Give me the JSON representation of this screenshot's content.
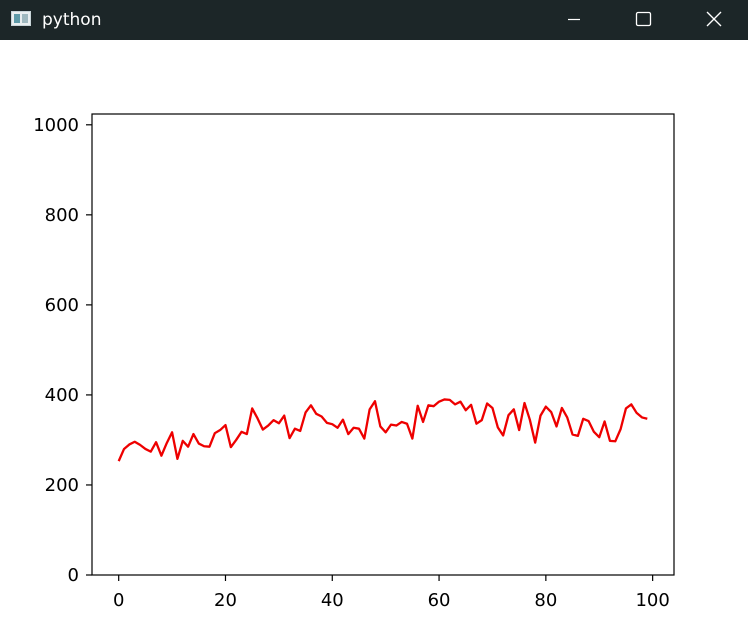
{
  "window": {
    "title": "python",
    "icons": {
      "app": "python-figure-icon",
      "minimize": "minimize-icon",
      "maximize": "maximize-icon",
      "close": "close-icon"
    }
  },
  "colors": {
    "titlebar": "#1c2628",
    "line": "#ee0000",
    "axes": "#000000",
    "background": "#ffffff"
  },
  "chart_data": {
    "type": "line",
    "title": "",
    "xlabel": "",
    "ylabel": "",
    "xlim": [
      -5,
      104
    ],
    "ylim": [
      0,
      1024
    ],
    "grid": false,
    "x_ticks": [
      "0",
      "20",
      "40",
      "60",
      "80",
      "100"
    ],
    "y_ticks": [
      "0",
      "200",
      "400",
      "600",
      "800",
      "1000"
    ],
    "series": [
      {
        "x": [
          0,
          1,
          2,
          3,
          4,
          5,
          6,
          7,
          8,
          9,
          10,
          11,
          12,
          13,
          14,
          15,
          16,
          17,
          18,
          19,
          20,
          21,
          22,
          23,
          24,
          25,
          26,
          27,
          28,
          29,
          30,
          31,
          32,
          33,
          34,
          35,
          36,
          37,
          38,
          39,
          40,
          41,
          42,
          43,
          44,
          45,
          46,
          47,
          48,
          49,
          50,
          51,
          52,
          53,
          54,
          55,
          56,
          57,
          58,
          59,
          60,
          61,
          62,
          63,
          64,
          65,
          66,
          67,
          68,
          69,
          70,
          71,
          72,
          73,
          74,
          75,
          76,
          77,
          78,
          79,
          80,
          81,
          82,
          83,
          84,
          85,
          86,
          87,
          88,
          89,
          90,
          91,
          92,
          93,
          94,
          95,
          96,
          97,
          98,
          99
        ],
        "y": [
          253,
          280,
          290,
          296,
          289,
          280,
          274,
          295,
          265,
          293,
          317,
          258,
          298,
          285,
          313,
          292,
          286,
          285,
          315,
          322,
          333,
          284,
          300,
          318,
          313,
          370,
          348,
          323,
          332,
          344,
          337,
          354,
          304,
          325,
          320,
          361,
          377,
          358,
          352,
          338,
          335,
          327,
          345,
          313,
          327,
          325,
          303,
          368,
          386,
          330,
          317,
          334,
          332,
          340,
          336,
          303,
          376,
          340,
          377,
          375,
          385,
          390,
          389,
          379,
          385,
          366,
          378,
          336,
          344,
          381,
          371,
          328,
          310,
          355,
          368,
          322,
          382,
          345,
          294,
          354,
          374,
          362,
          330,
          371,
          350,
          312,
          309,
          347,
          342,
          318,
          306,
          341,
          298,
          297,
          324,
          370,
          379,
          360,
          350,
          347
        ]
      }
    ]
  }
}
